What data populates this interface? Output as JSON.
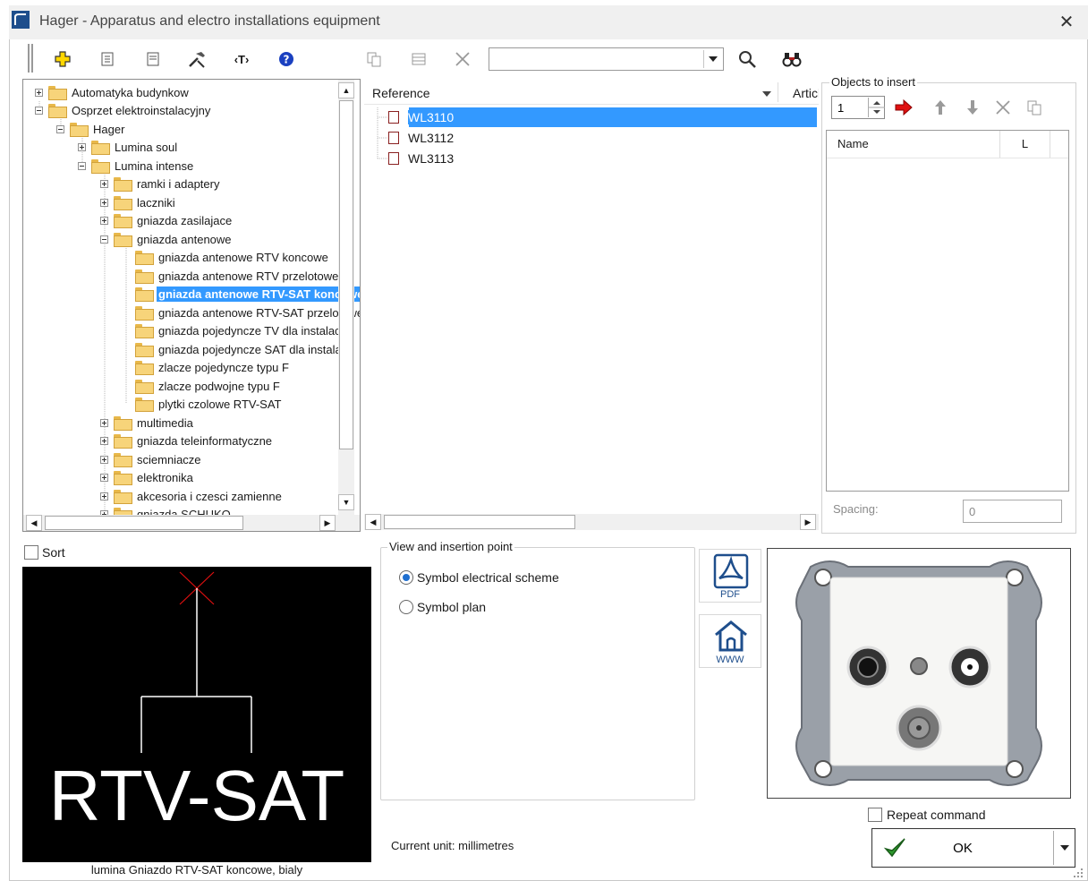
{
  "window": {
    "title": "Hager - Apparatus and electro installations equipment"
  },
  "search": {
    "value": ""
  },
  "tree": {
    "items": [
      {
        "label": "Automatyka budynkow"
      },
      {
        "label": "Osprzet elektroinstalacyjny"
      },
      {
        "label": "Hager"
      },
      {
        "label": "Lumina soul"
      },
      {
        "label": "Lumina intense"
      },
      {
        "label": "ramki i adaptery"
      },
      {
        "label": "laczniki"
      },
      {
        "label": "gniazda zasilajace"
      },
      {
        "label": "gniazda antenowe"
      },
      {
        "label": "gniazda antenowe RTV koncowe"
      },
      {
        "label": "gniazda antenowe RTV przelotowe"
      },
      {
        "label": "gniazda antenowe RTV-SAT koncowe"
      },
      {
        "label": "gniazda antenowe RTV-SAT przelotowe"
      },
      {
        "label": "gniazda pojedyncze TV dla instalacji"
      },
      {
        "label": "gniazda pojedyncze SAT dla instalacji"
      },
      {
        "label": "zlacze pojedyncze typu F"
      },
      {
        "label": "zlacze podwojne typu F"
      },
      {
        "label": "plytki czolowe RTV-SAT"
      },
      {
        "label": "multimedia"
      },
      {
        "label": "gniazda teleinformatyczne"
      },
      {
        "label": "sciemniacze"
      },
      {
        "label": "elektronika"
      },
      {
        "label": "akcesoria i czesci zamienne"
      },
      {
        "label": "gniazda SCHUKO"
      }
    ]
  },
  "references": {
    "column_reference": "Reference",
    "column_article": "Article",
    "items": [
      "WL3110",
      "WL3112",
      "WL3113"
    ]
  },
  "objects": {
    "legend": "Objects to insert",
    "count": "1",
    "col_name": "Name",
    "col_l": "L",
    "spacing_label": "Spacing:",
    "spacing_value": "0"
  },
  "sort": {
    "label": "Sort"
  },
  "preview": {
    "symbol_text": "RTV-SAT",
    "caption": "lumina Gniazdo RTV-SAT koncowe, bialy"
  },
  "view": {
    "legend": "View and insertion point",
    "opt_scheme": "Symbol electrical scheme",
    "opt_plan": "Symbol plan"
  },
  "unit": {
    "text": "Current unit: millimetres"
  },
  "side": {
    "pdf": "PDF",
    "www": "WWW"
  },
  "repeat": {
    "label": "Repeat command"
  },
  "ok": {
    "label": "OK"
  },
  "colors": {
    "selection": "#3399ff",
    "accent": "#1e4e8c"
  },
  "icons": [
    "app-icon",
    "close-icon",
    "add-icon",
    "sheet-icon",
    "page-icon",
    "tools-icon",
    "text-tag-icon",
    "help-icon",
    "copy-icon",
    "grid-icon",
    "delete-icon",
    "chevron-down-icon",
    "search-icon",
    "binoculars-icon",
    "arrow-right-icon",
    "arrow-up-icon",
    "arrow-down-icon",
    "pdf-icon",
    "home-icon",
    "checkmark-icon"
  ]
}
